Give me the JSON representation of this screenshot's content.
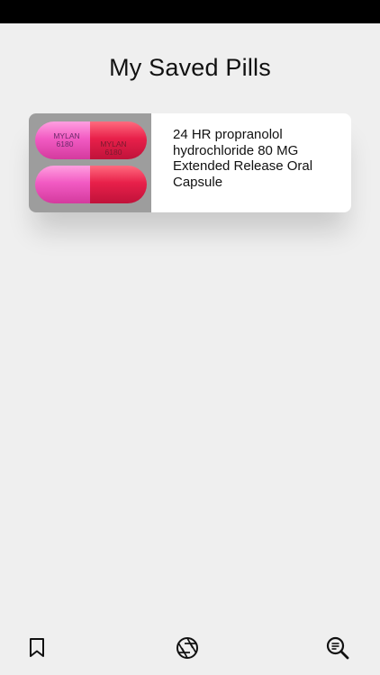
{
  "header": {
    "title": "My Saved Pills"
  },
  "saved_pills": [
    {
      "name": "24 HR propranolol hydrochloride 80 MG Extended Release Oral Capsule",
      "imprint_line1": "MYLAN",
      "imprint_line2": "6180",
      "colors": {
        "cap_light": "#f25bc3",
        "cap_dark": "#e8204a",
        "background": "#9d9d9d"
      }
    }
  ],
  "tab_bar": {
    "items": [
      {
        "icon": "bookmark-icon"
      },
      {
        "icon": "camera-aperture-icon"
      },
      {
        "icon": "search-list-icon"
      }
    ]
  }
}
